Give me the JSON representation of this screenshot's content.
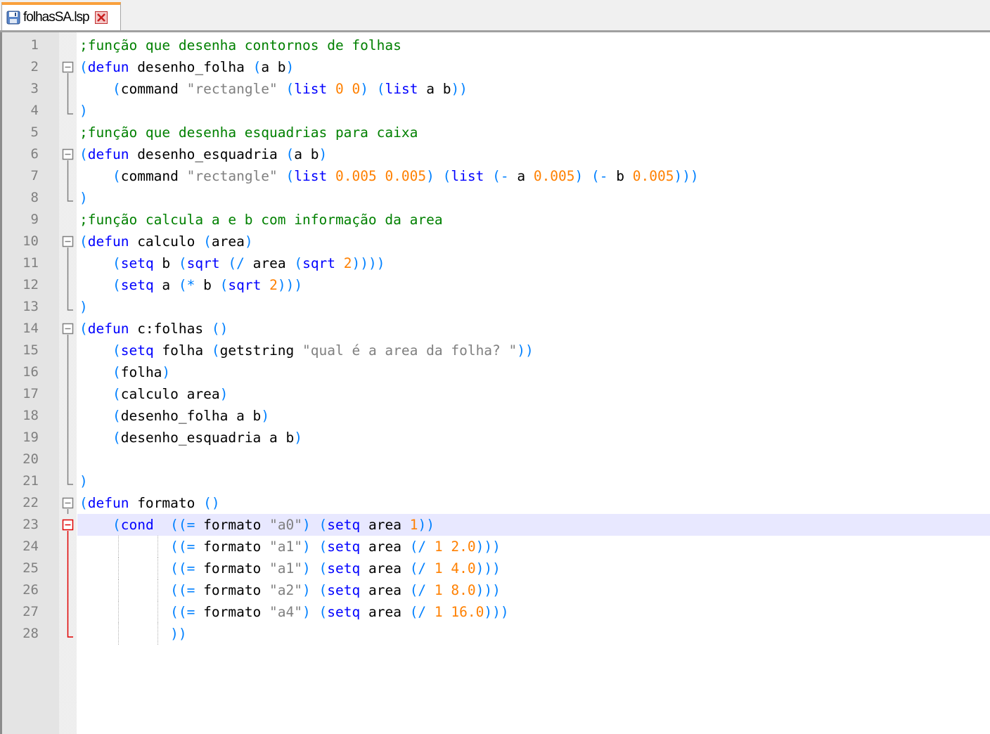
{
  "tab": {
    "filename": "folhasSA.lsp",
    "icon": "save-icon",
    "close_icon": "close-icon"
  },
  "colors": {
    "comment": "#008000",
    "keyword": "#0000ff",
    "paren": "#0080ff",
    "string": "#808080",
    "number": "#ff8000",
    "fold_active": "#e00000",
    "current_line": "#e8e8ff"
  },
  "current_line": 23,
  "lines": [
    {
      "n": "1",
      "fold": "",
      "tokens": [
        [
          "cm",
          ";função que desenha contornos de folhas"
        ]
      ]
    },
    {
      "n": "2",
      "fold": "box",
      "tokens": [
        [
          "pr",
          "("
        ],
        [
          "kw",
          "defun"
        ],
        [
          "t",
          " desenho_folha "
        ],
        [
          "pr",
          "("
        ],
        [
          "t",
          "a b"
        ],
        [
          "pr",
          ")"
        ]
      ]
    },
    {
      "n": "3",
      "fold": "line",
      "tokens": [
        [
          "t",
          "    "
        ],
        [
          "pr",
          "("
        ],
        [
          "t",
          "command "
        ],
        [
          "st",
          "\"rectangle\""
        ],
        [
          "t",
          " "
        ],
        [
          "pr",
          "("
        ],
        [
          "kw",
          "list"
        ],
        [
          "t",
          " "
        ],
        [
          "nu",
          "0"
        ],
        [
          "t",
          " "
        ],
        [
          "nu",
          "0"
        ],
        [
          "pr",
          ")"
        ],
        [
          "t",
          " "
        ],
        [
          "pr",
          "("
        ],
        [
          "kw",
          "list"
        ],
        [
          "t",
          " a b"
        ],
        [
          "pr",
          "))"
        ]
      ]
    },
    {
      "n": "4",
      "fold": "end",
      "tokens": [
        [
          "pr",
          ")"
        ]
      ]
    },
    {
      "n": "5",
      "fold": "",
      "tokens": [
        [
          "cm",
          ";função que desenha esquadrias para caixa"
        ]
      ]
    },
    {
      "n": "6",
      "fold": "box",
      "tokens": [
        [
          "pr",
          "("
        ],
        [
          "kw",
          "defun"
        ],
        [
          "t",
          " desenho_esquadria "
        ],
        [
          "pr",
          "("
        ],
        [
          "t",
          "a b"
        ],
        [
          "pr",
          ")"
        ]
      ]
    },
    {
      "n": "7",
      "fold": "line",
      "tokens": [
        [
          "t",
          "    "
        ],
        [
          "pr",
          "("
        ],
        [
          "t",
          "command "
        ],
        [
          "st",
          "\"rectangle\""
        ],
        [
          "t",
          " "
        ],
        [
          "pr",
          "("
        ],
        [
          "kw",
          "list"
        ],
        [
          "t",
          " "
        ],
        [
          "nu",
          "0.005 0.005"
        ],
        [
          "pr",
          ")"
        ],
        [
          "t",
          " "
        ],
        [
          "pr",
          "("
        ],
        [
          "kw",
          "list"
        ],
        [
          "t",
          " "
        ],
        [
          "pr",
          "(-"
        ],
        [
          "t",
          " a "
        ],
        [
          "nu",
          "0.005"
        ],
        [
          "pr",
          ")"
        ],
        [
          "t",
          " "
        ],
        [
          "pr",
          "(-"
        ],
        [
          "t",
          " b "
        ],
        [
          "nu",
          "0.005"
        ],
        [
          "pr",
          ")))"
        ]
      ]
    },
    {
      "n": "8",
      "fold": "end",
      "tokens": [
        [
          "pr",
          ")"
        ]
      ]
    },
    {
      "n": "9",
      "fold": "",
      "tokens": [
        [
          "cm",
          ";função calcula a e b com informação da area"
        ]
      ]
    },
    {
      "n": "10",
      "fold": "box",
      "tokens": [
        [
          "pr",
          "("
        ],
        [
          "kw",
          "defun"
        ],
        [
          "t",
          " calculo "
        ],
        [
          "pr",
          "("
        ],
        [
          "t",
          "area"
        ],
        [
          "pr",
          ")"
        ]
      ]
    },
    {
      "n": "11",
      "fold": "line",
      "tokens": [
        [
          "t",
          "    "
        ],
        [
          "pr",
          "("
        ],
        [
          "kw",
          "setq"
        ],
        [
          "t",
          " b "
        ],
        [
          "pr",
          "("
        ],
        [
          "kw",
          "sqrt"
        ],
        [
          "t",
          " "
        ],
        [
          "pr",
          "(/"
        ],
        [
          "t",
          " area "
        ],
        [
          "pr",
          "("
        ],
        [
          "kw",
          "sqrt"
        ],
        [
          "t",
          " "
        ],
        [
          "nu",
          "2"
        ],
        [
          "pr",
          "))))"
        ]
      ]
    },
    {
      "n": "12",
      "fold": "line",
      "tokens": [
        [
          "t",
          "    "
        ],
        [
          "pr",
          "("
        ],
        [
          "kw",
          "setq"
        ],
        [
          "t",
          " a "
        ],
        [
          "pr",
          "(*"
        ],
        [
          "t",
          " b "
        ],
        [
          "pr",
          "("
        ],
        [
          "kw",
          "sqrt"
        ],
        [
          "t",
          " "
        ],
        [
          "nu",
          "2"
        ],
        [
          "pr",
          ")))"
        ]
      ]
    },
    {
      "n": "13",
      "fold": "end",
      "tokens": [
        [
          "pr",
          ")"
        ]
      ]
    },
    {
      "n": "14",
      "fold": "box",
      "tokens": [
        [
          "pr",
          "("
        ],
        [
          "kw",
          "defun"
        ],
        [
          "t",
          " c:folhas "
        ],
        [
          "pr",
          "()"
        ]
      ]
    },
    {
      "n": "15",
      "fold": "line",
      "tokens": [
        [
          "t",
          "    "
        ],
        [
          "pr",
          "("
        ],
        [
          "kw",
          "setq"
        ],
        [
          "t",
          " folha "
        ],
        [
          "pr",
          "("
        ],
        [
          "t",
          "getstring "
        ],
        [
          "st",
          "\"qual é a area da folha? \""
        ],
        [
          "pr",
          "))"
        ]
      ]
    },
    {
      "n": "16",
      "fold": "line",
      "tokens": [
        [
          "t",
          "    "
        ],
        [
          "pr",
          "("
        ],
        [
          "t",
          "folha"
        ],
        [
          "pr",
          ")"
        ]
      ]
    },
    {
      "n": "17",
      "fold": "line",
      "tokens": [
        [
          "t",
          "    "
        ],
        [
          "pr",
          "("
        ],
        [
          "t",
          "calculo area"
        ],
        [
          "pr",
          ")"
        ]
      ]
    },
    {
      "n": "18",
      "fold": "line",
      "tokens": [
        [
          "t",
          "    "
        ],
        [
          "pr",
          "("
        ],
        [
          "t",
          "desenho_folha a b"
        ],
        [
          "pr",
          ")"
        ]
      ]
    },
    {
      "n": "19",
      "fold": "line",
      "tokens": [
        [
          "t",
          "    "
        ],
        [
          "pr",
          "("
        ],
        [
          "t",
          "desenho_esquadria a b"
        ],
        [
          "pr",
          ")"
        ]
      ]
    },
    {
      "n": "20",
      "fold": "line",
      "tokens": []
    },
    {
      "n": "21",
      "fold": "end",
      "tokens": [
        [
          "pr",
          ")"
        ]
      ]
    },
    {
      "n": "22",
      "fold": "box",
      "tokens": [
        [
          "pr",
          "("
        ],
        [
          "kw",
          "defun"
        ],
        [
          "t",
          " formato "
        ],
        [
          "pr",
          "()"
        ]
      ]
    },
    {
      "n": "23",
      "fold": "box-red",
      "tokens": [
        [
          "t",
          "    "
        ],
        [
          "pr",
          "("
        ],
        [
          "kw",
          "cond"
        ],
        [
          "t",
          "  "
        ],
        [
          "pr",
          "((="
        ],
        [
          "t",
          " formato "
        ],
        [
          "st",
          "\"a0\""
        ],
        [
          "pr",
          ")"
        ],
        [
          "t",
          " "
        ],
        [
          "pr",
          "("
        ],
        [
          "kw",
          "setq"
        ],
        [
          "t",
          " area "
        ],
        [
          "nu",
          "1"
        ],
        [
          "pr",
          "))"
        ]
      ]
    },
    {
      "n": "24",
      "fold": "line-red",
      "tokens": [
        [
          "t",
          "           "
        ],
        [
          "pr",
          "((="
        ],
        [
          "t",
          " formato "
        ],
        [
          "st",
          "\"a1\""
        ],
        [
          "pr",
          ")"
        ],
        [
          "t",
          " "
        ],
        [
          "pr",
          "("
        ],
        [
          "kw",
          "setq"
        ],
        [
          "t",
          " area "
        ],
        [
          "pr",
          "(/"
        ],
        [
          "t",
          " "
        ],
        [
          "nu",
          "1"
        ],
        [
          "t",
          " "
        ],
        [
          "nu",
          "2.0"
        ],
        [
          "pr",
          ")))"
        ]
      ]
    },
    {
      "n": "25",
      "fold": "line-red",
      "tokens": [
        [
          "t",
          "           "
        ],
        [
          "pr",
          "((="
        ],
        [
          "t",
          " formato "
        ],
        [
          "st",
          "\"a1\""
        ],
        [
          "pr",
          ")"
        ],
        [
          "t",
          " "
        ],
        [
          "pr",
          "("
        ],
        [
          "kw",
          "setq"
        ],
        [
          "t",
          " area "
        ],
        [
          "pr",
          "(/"
        ],
        [
          "t",
          " "
        ],
        [
          "nu",
          "1"
        ],
        [
          "t",
          " "
        ],
        [
          "nu",
          "4.0"
        ],
        [
          "pr",
          ")))"
        ]
      ]
    },
    {
      "n": "26",
      "fold": "line-red",
      "tokens": [
        [
          "t",
          "           "
        ],
        [
          "pr",
          "((="
        ],
        [
          "t",
          " formato "
        ],
        [
          "st",
          "\"a2\""
        ],
        [
          "pr",
          ")"
        ],
        [
          "t",
          " "
        ],
        [
          "pr",
          "("
        ],
        [
          "kw",
          "setq"
        ],
        [
          "t",
          " area "
        ],
        [
          "pr",
          "(/"
        ],
        [
          "t",
          " "
        ],
        [
          "nu",
          "1"
        ],
        [
          "t",
          " "
        ],
        [
          "nu",
          "8.0"
        ],
        [
          "pr",
          ")))"
        ]
      ]
    },
    {
      "n": "27",
      "fold": "line-red",
      "tokens": [
        [
          "t",
          "           "
        ],
        [
          "pr",
          "((="
        ],
        [
          "t",
          " formato "
        ],
        [
          "st",
          "\"a4\""
        ],
        [
          "pr",
          ")"
        ],
        [
          "t",
          " "
        ],
        [
          "pr",
          "("
        ],
        [
          "kw",
          "setq"
        ],
        [
          "t",
          " area "
        ],
        [
          "pr",
          "(/"
        ],
        [
          "t",
          " "
        ],
        [
          "nu",
          "1"
        ],
        [
          "t",
          " "
        ],
        [
          "nu",
          "16.0"
        ],
        [
          "pr",
          ")))"
        ]
      ]
    },
    {
      "n": "28",
      "fold": "end-red",
      "tokens": [
        [
          "t",
          "           "
        ],
        [
          "pr",
          "))"
        ]
      ]
    }
  ]
}
